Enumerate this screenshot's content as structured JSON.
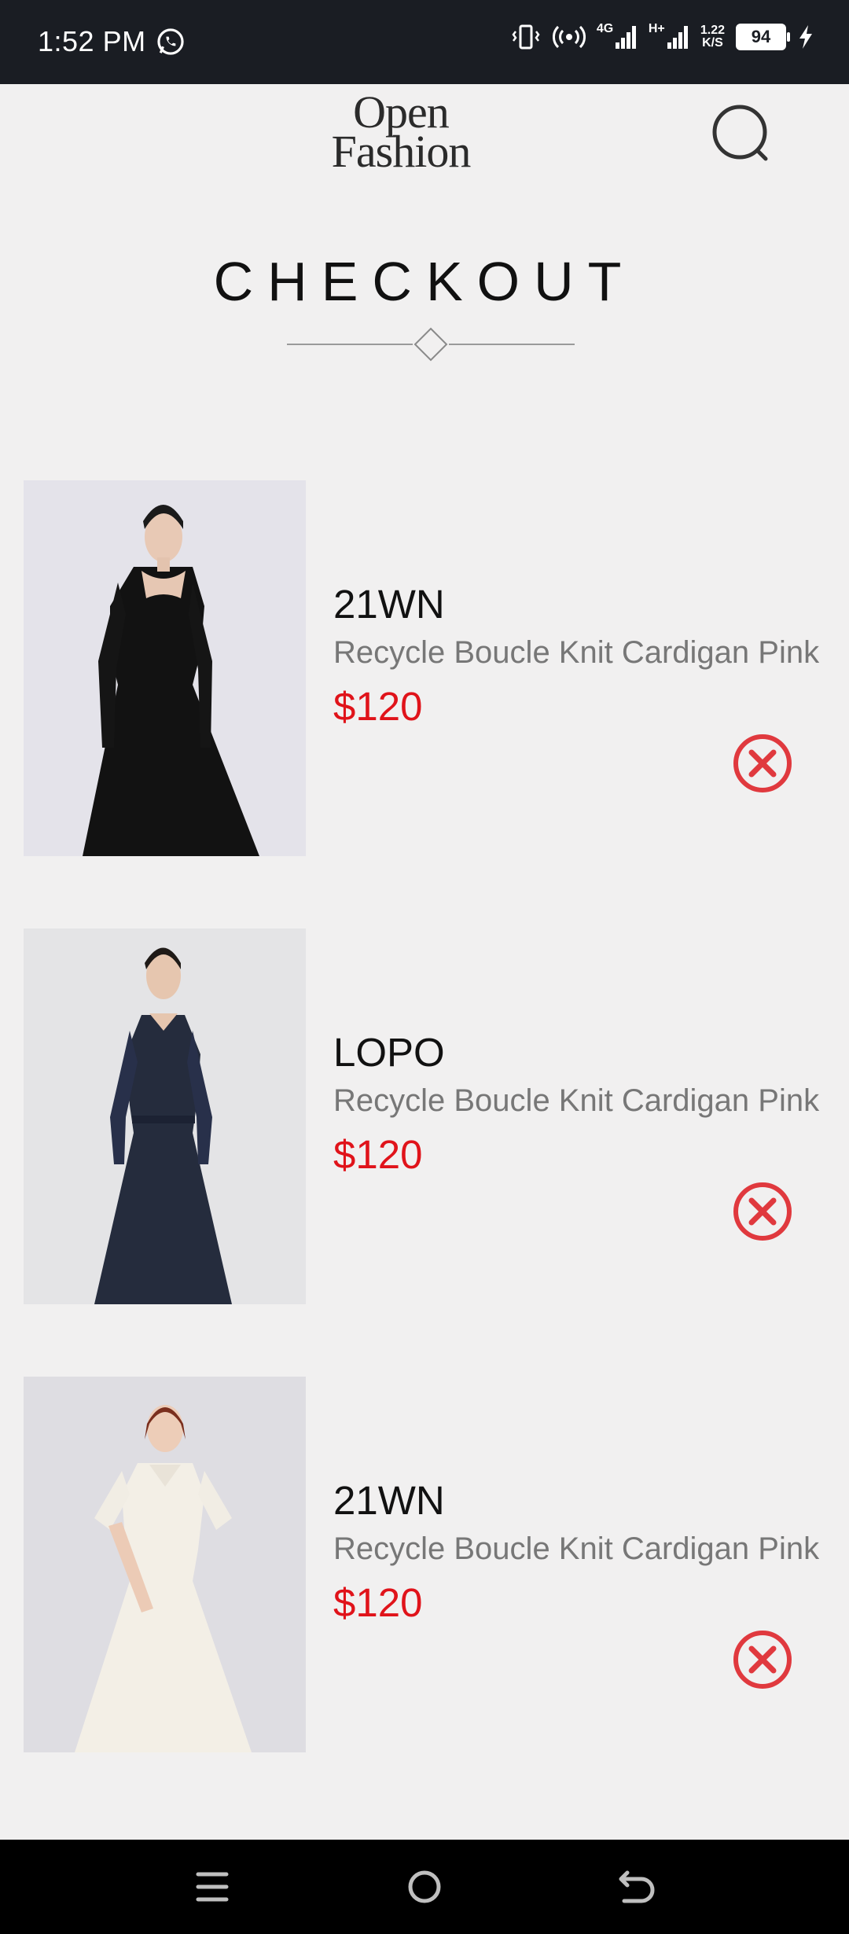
{
  "status_bar": {
    "time": "1:52 PM",
    "battery": "94",
    "net_speed_value": "1.22",
    "net_speed_unit": "K/S",
    "network_4g": "4G",
    "network_hplus": "H+",
    "icons": [
      "whatsapp-icon",
      "vibrate-icon",
      "hotspot-icon",
      "signal-icon",
      "signal-icon",
      "battery-icon",
      "charging-icon"
    ]
  },
  "header": {
    "logo_line1": "Open",
    "logo_line2": "Fashion",
    "search_icon": "search-icon"
  },
  "page": {
    "title": "CHECKOUT"
  },
  "cart": {
    "items": [
      {
        "brand": "21WN",
        "description": "Recycle Boucle Knit Cardigan Pink",
        "price": "$120",
        "image": "black dress"
      },
      {
        "brand": "LOPO",
        "description": "Recycle Boucle Knit Cardigan Pink",
        "price": "$120",
        "image": "navy dress"
      },
      {
        "brand": "21WN",
        "description": "Recycle Boucle Knit Cardigan Pink",
        "price": "$120",
        "image": "cream dress"
      }
    ]
  },
  "colors": {
    "price": "#e0131a",
    "remove": "#e0393e",
    "background": "#f1f0f0",
    "status_bar": "#1a1d23"
  },
  "nav_bar": {
    "icons": [
      "menu-icon",
      "home-icon",
      "back-icon"
    ]
  }
}
